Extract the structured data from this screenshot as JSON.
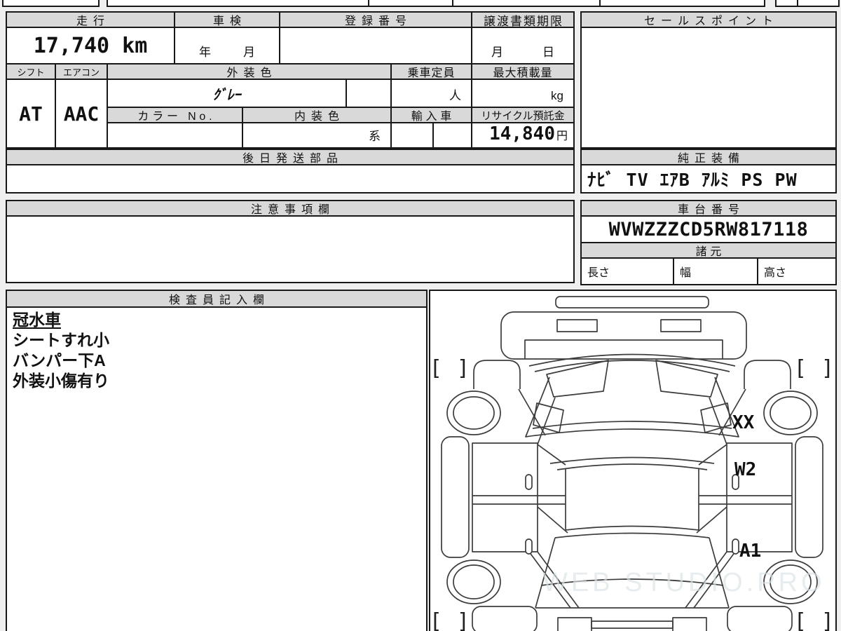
{
  "page": {
    "background": "#efefef",
    "line_color": "#181818",
    "header_fill": "#d9d9d9"
  },
  "table": {
    "mileage": {
      "header": "走行",
      "value": "17,740 km"
    },
    "inspection": {
      "header": "車検",
      "year_unit": "年",
      "month_unit": "月"
    },
    "registration": {
      "header": "登録番号",
      "value": ""
    },
    "transfer_deadline": {
      "header": "譲渡書類期限",
      "month_unit": "月",
      "day_unit": "日"
    },
    "shift": {
      "header": "シフト",
      "value": "AT"
    },
    "aircon": {
      "header": "エアコン",
      "value": "AAC"
    },
    "exterior_color": {
      "header": "外装色",
      "value": "ｸﾞﾚｰ"
    },
    "capacity": {
      "header": "乗車定員",
      "unit": "人",
      "value": ""
    },
    "max_load": {
      "header": "最大積載量",
      "unit": "kg",
      "value": ""
    },
    "color_no": {
      "header": "カラー No.",
      "value": ""
    },
    "interior_color": {
      "header": "内装色",
      "suffix": "系",
      "value": ""
    },
    "import_car": {
      "header": "輸入車",
      "value": ""
    },
    "recycle_deposit": {
      "header": "リサイクル預託金",
      "value": "14,840",
      "unit": "円"
    },
    "later_shipped_parts": {
      "header": "後日発送部品",
      "value": ""
    }
  },
  "sales_point": {
    "header": "セールスポイント",
    "value": ""
  },
  "genuine_equipment": {
    "header": "純正装備",
    "value": "ﾅﾋﾞ TV ｴｱB ｱﾙﾐ PS PW"
  },
  "caution_notes": {
    "header": "注意事項欄",
    "value": ""
  },
  "chassis_number": {
    "header": "車台番号",
    "value": "WVWZZZCD5RW817118"
  },
  "specs": {
    "header": "諸元",
    "length_label": "長さ",
    "width_label": "幅",
    "height_label": "高さ",
    "length_value": "",
    "width_value": "",
    "height_value": ""
  },
  "inspector_field": {
    "header": "検査員記入欄",
    "notes": [
      "冠水車",
      "シートすれ小",
      "バンパー下A",
      "外装小傷有り"
    ]
  },
  "diagram": {
    "label_xx": "XX",
    "label_w2": "W2",
    "label_a1": "A1",
    "bracket_open": "[",
    "bracket_close": "]",
    "watermark": "WEB STUDIO.PRO"
  }
}
